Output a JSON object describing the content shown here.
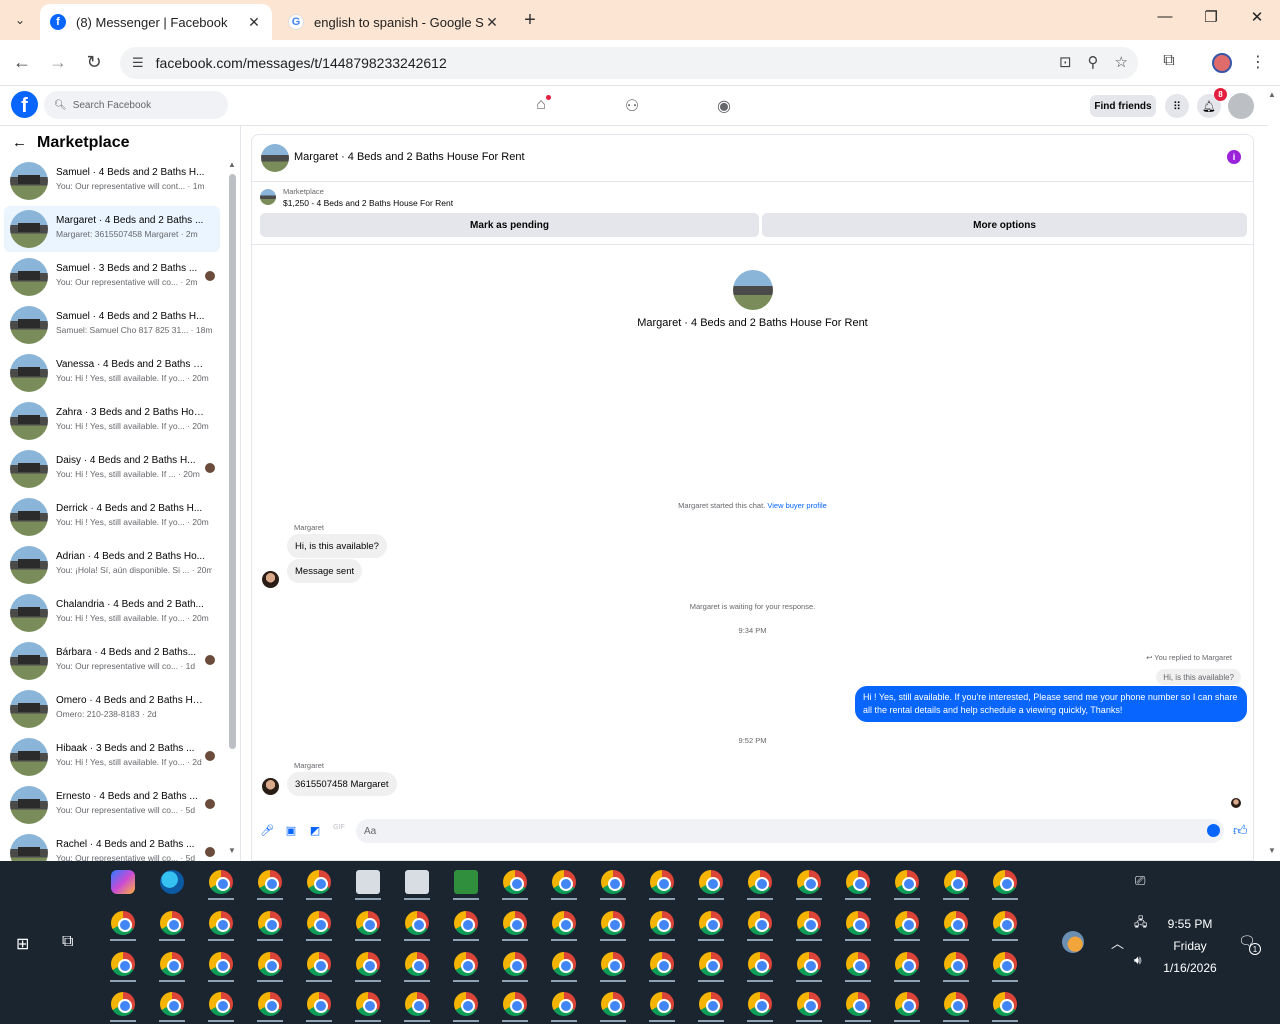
{
  "browser": {
    "tabs": [
      {
        "title": "(8) Messenger | Facebook",
        "active": true
      },
      {
        "title": "english to spanish - Google Sea",
        "active": false
      }
    ],
    "url": "facebook.com/messages/t/1448798233242612"
  },
  "fb_header": {
    "search_placeholder": "Search Facebook",
    "find_friends": "Find friends",
    "notification_count": "8"
  },
  "sidebar": {
    "title": "Marketplace",
    "conversations": [
      {
        "name": "Samuel · 4 Beds and 2 Baths H...",
        "snippet": "You: Our representative will cont... · 1m",
        "active": false,
        "read_dot": false
      },
      {
        "name": "Margaret · 4 Beds and 2 Baths ...",
        "snippet": "Margaret: 3615507458 Margaret · 2m",
        "active": true,
        "read_dot": false
      },
      {
        "name": "Samuel · 3 Beds and 2 Baths ...",
        "snippet": "You: Our representative will co... · 2m",
        "active": false,
        "read_dot": true
      },
      {
        "name": "Samuel · 4 Beds and 2 Baths H...",
        "snippet": "Samuel: Samuel Cho 817 825 31... · 18m",
        "active": false,
        "read_dot": false
      },
      {
        "name": "Vanessa · 4 Beds and 2 Baths H...",
        "snippet": "You: Hi ! Yes, still available. If yo... · 20m",
        "active": false,
        "read_dot": false
      },
      {
        "name": "Zahra · 3 Beds and 2 Baths Hou...",
        "snippet": "You: Hi ! Yes, still available. If yo... · 20m",
        "active": false,
        "read_dot": false
      },
      {
        "name": "Daisy · 4 Beds and 2 Baths H...",
        "snippet": "You: Hi ! Yes, still available. If ... · 20m",
        "active": false,
        "read_dot": true
      },
      {
        "name": "Derrick · 4 Beds and 2 Baths H...",
        "snippet": "You: Hi ! Yes, still available. If yo... · 20m",
        "active": false,
        "read_dot": false
      },
      {
        "name": "Adrian · 4 Beds and 2 Baths Ho...",
        "snippet": "You: ¡Hola! Sí, aún disponible. Si ... · 20m",
        "active": false,
        "read_dot": false
      },
      {
        "name": "Chalandria · 4 Beds and 2 Bath...",
        "snippet": "You: Hi ! Yes, still available. If yo... · 20m",
        "active": false,
        "read_dot": false
      },
      {
        "name": "Bárbara · 4 Beds and 2 Baths...",
        "snippet": "You: Our representative will co... · 1d",
        "active": false,
        "read_dot": true
      },
      {
        "name": "Omero · 4 Beds and 2 Baths Ho...",
        "snippet": "Omero: 210-238-8183 · 2d",
        "active": false,
        "read_dot": false
      },
      {
        "name": "Hibaak · 3 Beds and 2 Baths ...",
        "snippet": "You: Hi ! Yes, still available. If yo... · 2d",
        "active": false,
        "read_dot": true
      },
      {
        "name": "Ernesto · 4 Beds and 2 Baths ...",
        "snippet": "You: Our representative will co... · 5d",
        "active": false,
        "read_dot": true
      },
      {
        "name": "Rachel · 4 Beds and 2 Baths ...",
        "snippet": "You: Our representative will co... · 5d",
        "active": false,
        "read_dot": true
      }
    ]
  },
  "chat": {
    "title": "Margaret · 4 Beds and 2 Baths House For Rent",
    "marketplace_label": "Marketplace",
    "listing": "$1,250 - 4 Beds and 2 Baths House For Rent",
    "mark_pending": "Mark as pending",
    "more_options": "More options",
    "profile_title": "Margaret · 4 Beds and 2 Baths House For Rent",
    "started_text": "Margaret started this chat.",
    "view_profile": "View buyer profile",
    "sender_name": "Margaret",
    "msg1": "Hi, is this available?",
    "msg2": "Message sent",
    "waiting": "Margaret is waiting for your response.",
    "time1": "9:34 PM",
    "replied_to": "You replied to Margaret",
    "quoted": "Hi, is this available?",
    "reply": "Hi ! Yes, still available. If you're interested, Please send me your phone number so I can share all the rental details and help schedule a viewing quickly, Thanks!",
    "time2": "9:52 PM",
    "sender_name2": "Margaret",
    "msg3": "3615507458 Margaret",
    "composer_placeholder": "Aa"
  },
  "taskbar": {
    "time": "9:55 PM",
    "day": "Friday",
    "date": "1/16/2026",
    "notification_count": "1"
  }
}
